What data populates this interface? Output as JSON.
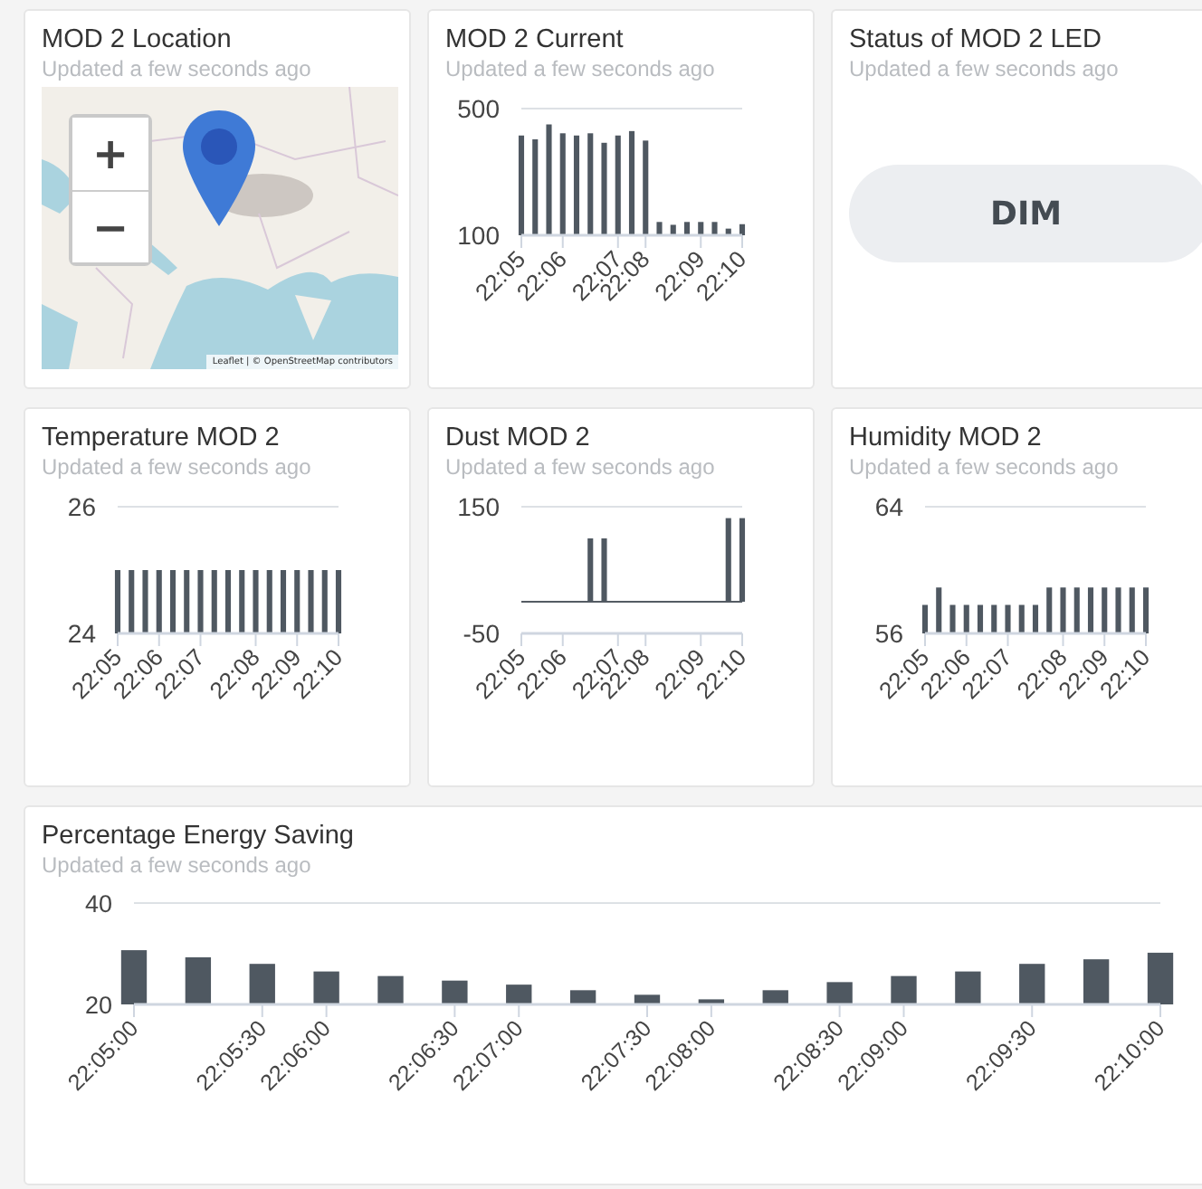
{
  "cards": [
    {
      "kind": "map",
      "title": "MOD 2 Location",
      "subtitle": "Updated a few seconds ago",
      "zoom_in": "+",
      "zoom_out": "−",
      "attribution": "Leaflet | © OpenStreetMap contributors"
    },
    {
      "kind": "chart",
      "title": "MOD 2 Current",
      "subtitle": "Updated a few seconds ago",
      "chart_data": {
        "type": "bar",
        "categories": [
          "22:05",
          null,
          null,
          "22:06",
          null,
          null,
          null,
          "22:07",
          null,
          "22:08",
          null,
          null,
          null,
          "22:09",
          null,
          null,
          "22:10"
        ],
        "values": [
          415,
          403,
          450,
          422,
          415,
          422,
          392,
          415,
          429,
          399,
          142,
          133,
          142,
          142,
          142,
          121,
          135
        ],
        "ylim": [
          100,
          500
        ],
        "yticks": [
          100,
          500
        ]
      }
    },
    {
      "kind": "status",
      "title": "Status of MOD 2 LED",
      "subtitle": "Updated a few seconds ago",
      "value": "DIM"
    },
    {
      "kind": "chart",
      "title": "Temperature MOD 2",
      "subtitle": "Updated a few seconds ago",
      "chart_data": {
        "type": "bar",
        "categories": [
          "22:05",
          null,
          null,
          "22:06",
          null,
          null,
          "22:07",
          null,
          null,
          null,
          "22:08",
          null,
          null,
          "22:09",
          null,
          null,
          "22:10"
        ],
        "values": [
          25,
          25,
          25,
          25,
          25,
          25,
          25,
          25,
          25,
          25,
          25,
          25,
          25,
          25,
          25,
          25,
          25
        ],
        "ylim": [
          24,
          26
        ],
        "yticks": [
          24,
          26
        ]
      }
    },
    {
      "kind": "chart",
      "title": "Dust MOD 2",
      "subtitle": "Updated a few seconds ago",
      "chart_data": {
        "type": "bar",
        "categories": [
          "22:05",
          null,
          null,
          "22:06",
          null,
          null,
          null,
          "22:07",
          null,
          "22:08",
          null,
          null,
          null,
          "22:09",
          null,
          null,
          "22:10"
        ],
        "values": [
          0,
          0,
          0,
          0,
          0,
          100,
          100,
          0,
          0,
          0,
          0,
          0,
          0,
          0,
          0,
          132,
          132
        ],
        "ylim": [
          -50,
          150
        ],
        "yticks": [
          -50,
          150
        ]
      }
    },
    {
      "kind": "chart",
      "title": "Humidity MOD 2",
      "subtitle": "Updated a few seconds ago",
      "chart_data": {
        "type": "bar",
        "categories": [
          "22:05",
          null,
          null,
          "22:06",
          null,
          null,
          "22:07",
          null,
          null,
          null,
          "22:08",
          null,
          null,
          "22:09",
          null,
          null,
          "22:10"
        ],
        "values": [
          57.8,
          58.9,
          57.8,
          57.8,
          57.8,
          57.8,
          57.8,
          57.8,
          57.8,
          58.9,
          58.9,
          58.9,
          58.9,
          58.9,
          58.9,
          58.9,
          58.9
        ],
        "ylim": [
          56,
          64
        ],
        "yticks": [
          56,
          64
        ]
      }
    },
    {
      "kind": "wide_chart",
      "title": "Percentage Energy Saving",
      "subtitle": "Updated a few seconds ago",
      "chart_data": {
        "type": "bar",
        "categories": [
          "22:05:00",
          null,
          "22:05:30",
          "22:06:00",
          null,
          "22:06:30",
          "22:07:00",
          null,
          "22:07:30",
          "22:08:00",
          null,
          "22:08:30",
          "22:09:00",
          null,
          "22:09:30",
          null,
          "22:10:00"
        ],
        "values": [
          30.7,
          29.3,
          28,
          26.5,
          25.6,
          24.7,
          23.9,
          22.8,
          21.9,
          21,
          22.8,
          24.4,
          25.6,
          26.5,
          28,
          28.9,
          30.2
        ],
        "ylim": [
          20,
          40
        ],
        "yticks": [
          20,
          40
        ]
      }
    }
  ]
}
